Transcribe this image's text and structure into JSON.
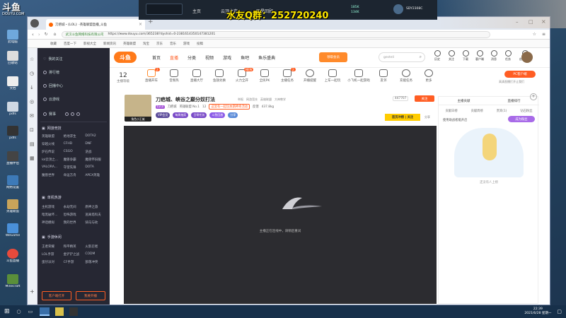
{
  "watermark": "斗鱼",
  "watermark_sub": "DOUYU.COM",
  "overlay": {
    "nav_home": "主页",
    "nav_game": "云顶之弈",
    "nav_rank": "观星回顾",
    "qq_group": "水友Q群：252720240",
    "stat_up": "185K",
    "stat_down": "134K",
    "user_id": "SDY2308C"
  },
  "desktop_icons": [
    {
      "label": "此电脑"
    },
    {
      "label": "回收站"
    },
    {
      "label": "文档"
    },
    {
      "label": "pdfs"
    },
    {
      "label": "pdfs"
    },
    {
      "label": "直播伴侣"
    },
    {
      "label": "网络设置"
    },
    {
      "label": "英雄联盟"
    },
    {
      "label": "WeGame"
    },
    {
      "label": "斗鱼直播"
    },
    {
      "label": "Minecraft"
    }
  ],
  "browser": {
    "tab_title": "刀疤城・《LOL》-英雄联盟直播_斗鱼",
    "address_host": "武汉斗鱼网络科技有限公司",
    "address_url": "https://www.douyu.com/365238?dyshid=0-2381614350147381201",
    "bookmarks": [
      "收藏",
      "百度一下",
      "影视大全",
      "新闻资讯",
      "英雄联盟",
      "淘宝",
      "京东",
      "音乐",
      "游戏",
      "投稿"
    ],
    "header": {
      "logo": "斗鱼",
      "nav": [
        "首页",
        "直播",
        "分类",
        "视频",
        "游戏",
        "鱼吧",
        "鱼乐盛典"
      ],
      "active_nav": "直播",
      "promo": "领取会员",
      "search_placeholder": "gesteli",
      "icons": [
        {
          "label": "历史"
        },
        {
          "label": "关注"
        },
        {
          "label": "下载"
        },
        {
          "label": "客户端"
        },
        {
          "label": "消息"
        },
        {
          "label": "任务"
        },
        {
          "label": "创作中心"
        }
      ]
    },
    "sidebar": {
      "items": [
        {
          "label": "我的关注"
        },
        {
          "label": "排行榜"
        },
        {
          "label": "回播中心"
        },
        {
          "label": "云游戏"
        }
      ],
      "sports_label": "赛事",
      "sections": [
        {
          "title": "网游竞技",
          "games": [
            "英雄联盟",
            "绝地求生",
            "DOTA2",
            "穿越火线",
            "CFHD",
            "DNF",
            "炉石传说",
            "CSGO",
            "逆战",
            "lol云顶之...",
            "魔兽争霸",
            "魔兽怀旧服",
            "VALORA...",
            "守望先锋",
            "DOTA",
            "魔兽世界",
            "命运方舟",
            "APEX英雄"
          ]
        },
        {
          "title": "单机热游",
          "games": [
            "主机游戏",
            "永劫无间",
            "原神之旅",
            "暗黑破坏...",
            "恐怖游戏",
            "逃离塔科夫",
            "神话模拟",
            "我的世界",
            "骑马与砍"
          ]
        },
        {
          "title": "手游休闲",
          "games": [
            "王者荣耀",
            "和平精英",
            "火影忍者",
            "LOL手游",
            "金铲铲之战",
            "CODM",
            "蛋仔派对",
            "CF手游",
            "部落冲突"
          ]
        }
      ],
      "btn_client": "客户端打开",
      "btn_live": "我要开播"
    },
    "toolbar": {
      "level": "12",
      "level_label": "主播等级",
      "tools": [
        {
          "label": "直播开车",
          "badge": "2"
        },
        {
          "label": "音频热"
        },
        {
          "label": "直播大厅"
        },
        {
          "label": "鱼翅兑换"
        },
        {
          "label": "火力全开",
          "badge": "NEW"
        },
        {
          "label": "全民PK"
        },
        {
          "label": "主播任务",
          "badge": "2"
        },
        {
          "label": "开播提醒"
        },
        {
          "label": "上车一起玩"
        },
        {
          "label": "小飞机一起游戏"
        },
        {
          "label": "友邻"
        },
        {
          "label": "充能任务"
        },
        {
          "label": "更多"
        }
      ],
      "pc_client": "PC客户端",
      "pc_client_sub": "高清直播打开让我们"
    },
    "room": {
      "title": "刀疤城、峡谷之巅分奴打法",
      "tags": [
        "举报",
        "网游竞技",
        "英雄联盟",
        "大神教学"
      ],
      "level_tag": "Lv.3",
      "streamer": "刀疤城",
      "rank": "英雄联盟 No.1",
      "followers": "12",
      "hot_text": "这里有一起玩本期神奇活动",
      "report": "反馈",
      "views": "437.8kg",
      "avatar_caption": "角色小王城",
      "chips": [
        "VIP会员",
        "每周抽奖",
        "日常任务",
        "斗鱼回放",
        "分享"
      ],
      "follow_count": "447707",
      "follow_btn": "关注",
      "rank_banner": "首页冲榜 | 关注",
      "share": "分享",
      "danmu_setting": "弹幕设置"
    },
    "player": {
      "status_text": "主播正在连线中，请稍后重试"
    },
    "right": {
      "tab_rank": "主播贡献",
      "tab_week": "直播排行",
      "subtabs": [
        "贡献日榜",
        "贡献周榜",
        "贵宾(1)",
        "钻石粉丝"
      ],
      "guard_text": "使用助战者能开启",
      "guard_btn": "成为粉丝",
      "empty_text": "还没有人上榜"
    }
  },
  "taskbar": {
    "time": "22:39",
    "date": "2021/6/28 星期一"
  }
}
